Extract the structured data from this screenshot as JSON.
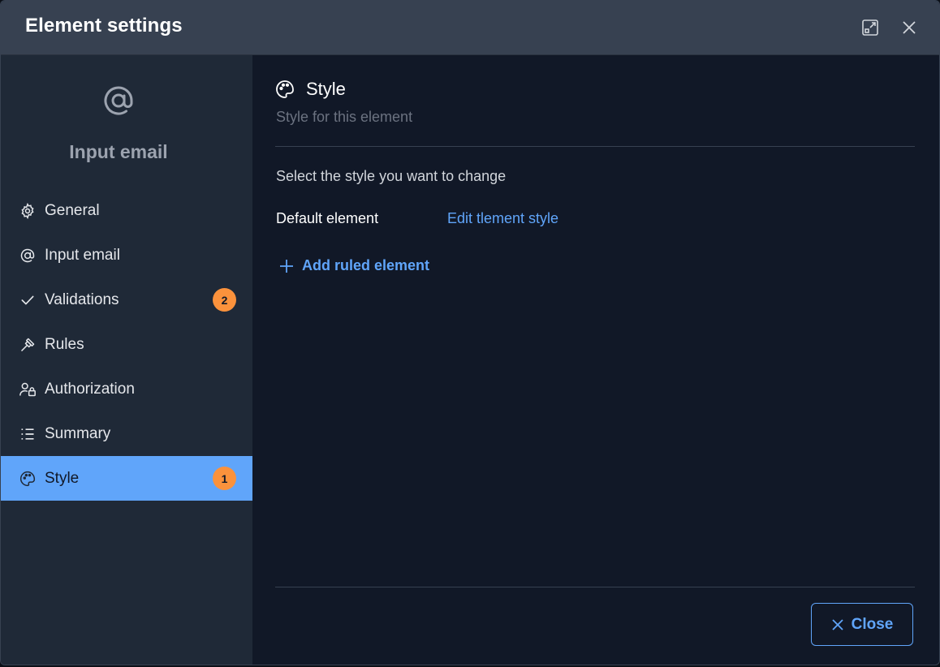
{
  "dialog": {
    "title": "Element settings"
  },
  "sidebar": {
    "element_icon": "at-sign-icon",
    "element_title": "Input email",
    "items": [
      {
        "label": "General",
        "icon": "gear-icon",
        "badge": ""
      },
      {
        "label": "Input email",
        "icon": "at-sign-icon",
        "badge": ""
      },
      {
        "label": "Validations",
        "icon": "check-icon",
        "badge": "2"
      },
      {
        "label": "Rules",
        "icon": "gavel-icon",
        "badge": ""
      },
      {
        "label": "Authorization",
        "icon": "user-lock-icon",
        "badge": ""
      },
      {
        "label": "Summary",
        "icon": "list-icon",
        "badge": ""
      },
      {
        "label": "Style",
        "icon": "palette-icon",
        "badge": "1",
        "active": true
      }
    ]
  },
  "main": {
    "section_title": "Style",
    "section_subtitle": "Style for this element",
    "prompt": "Select the style you want to change",
    "default_label": "Default element",
    "edit_link": "Edit tlement style",
    "add_button": "Add ruled element",
    "close_button": "Close"
  },
  "colors": {
    "accent": "#60a5fa",
    "badge": "#fb923c",
    "header_bg": "#374151",
    "sidebar_bg": "#1f2937",
    "content_bg": "#111827"
  }
}
